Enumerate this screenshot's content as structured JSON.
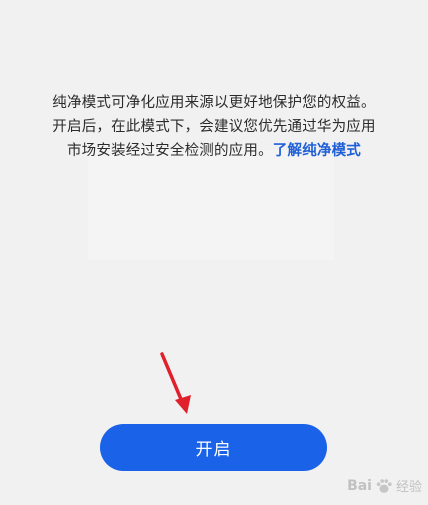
{
  "description": {
    "line1": "纯净模式可净化应用来源以更好地保护您的权益。",
    "line2": "开启后，在此模式下，会建议您优先通过华为应用",
    "line3_text": "市场安装经过安全检测的应用。",
    "line3_link": "了解纯净模式"
  },
  "enable_button": {
    "label": "开启"
  },
  "watermark": {
    "brand": "Bai",
    "suffix": "经验"
  },
  "colors": {
    "accent": "#1a62e8",
    "link": "#1f5fd8",
    "arrow": "#e0202a"
  },
  "icons": {
    "arrow": "red-pointer-arrow",
    "watermark": "baidu-paw-icon"
  }
}
